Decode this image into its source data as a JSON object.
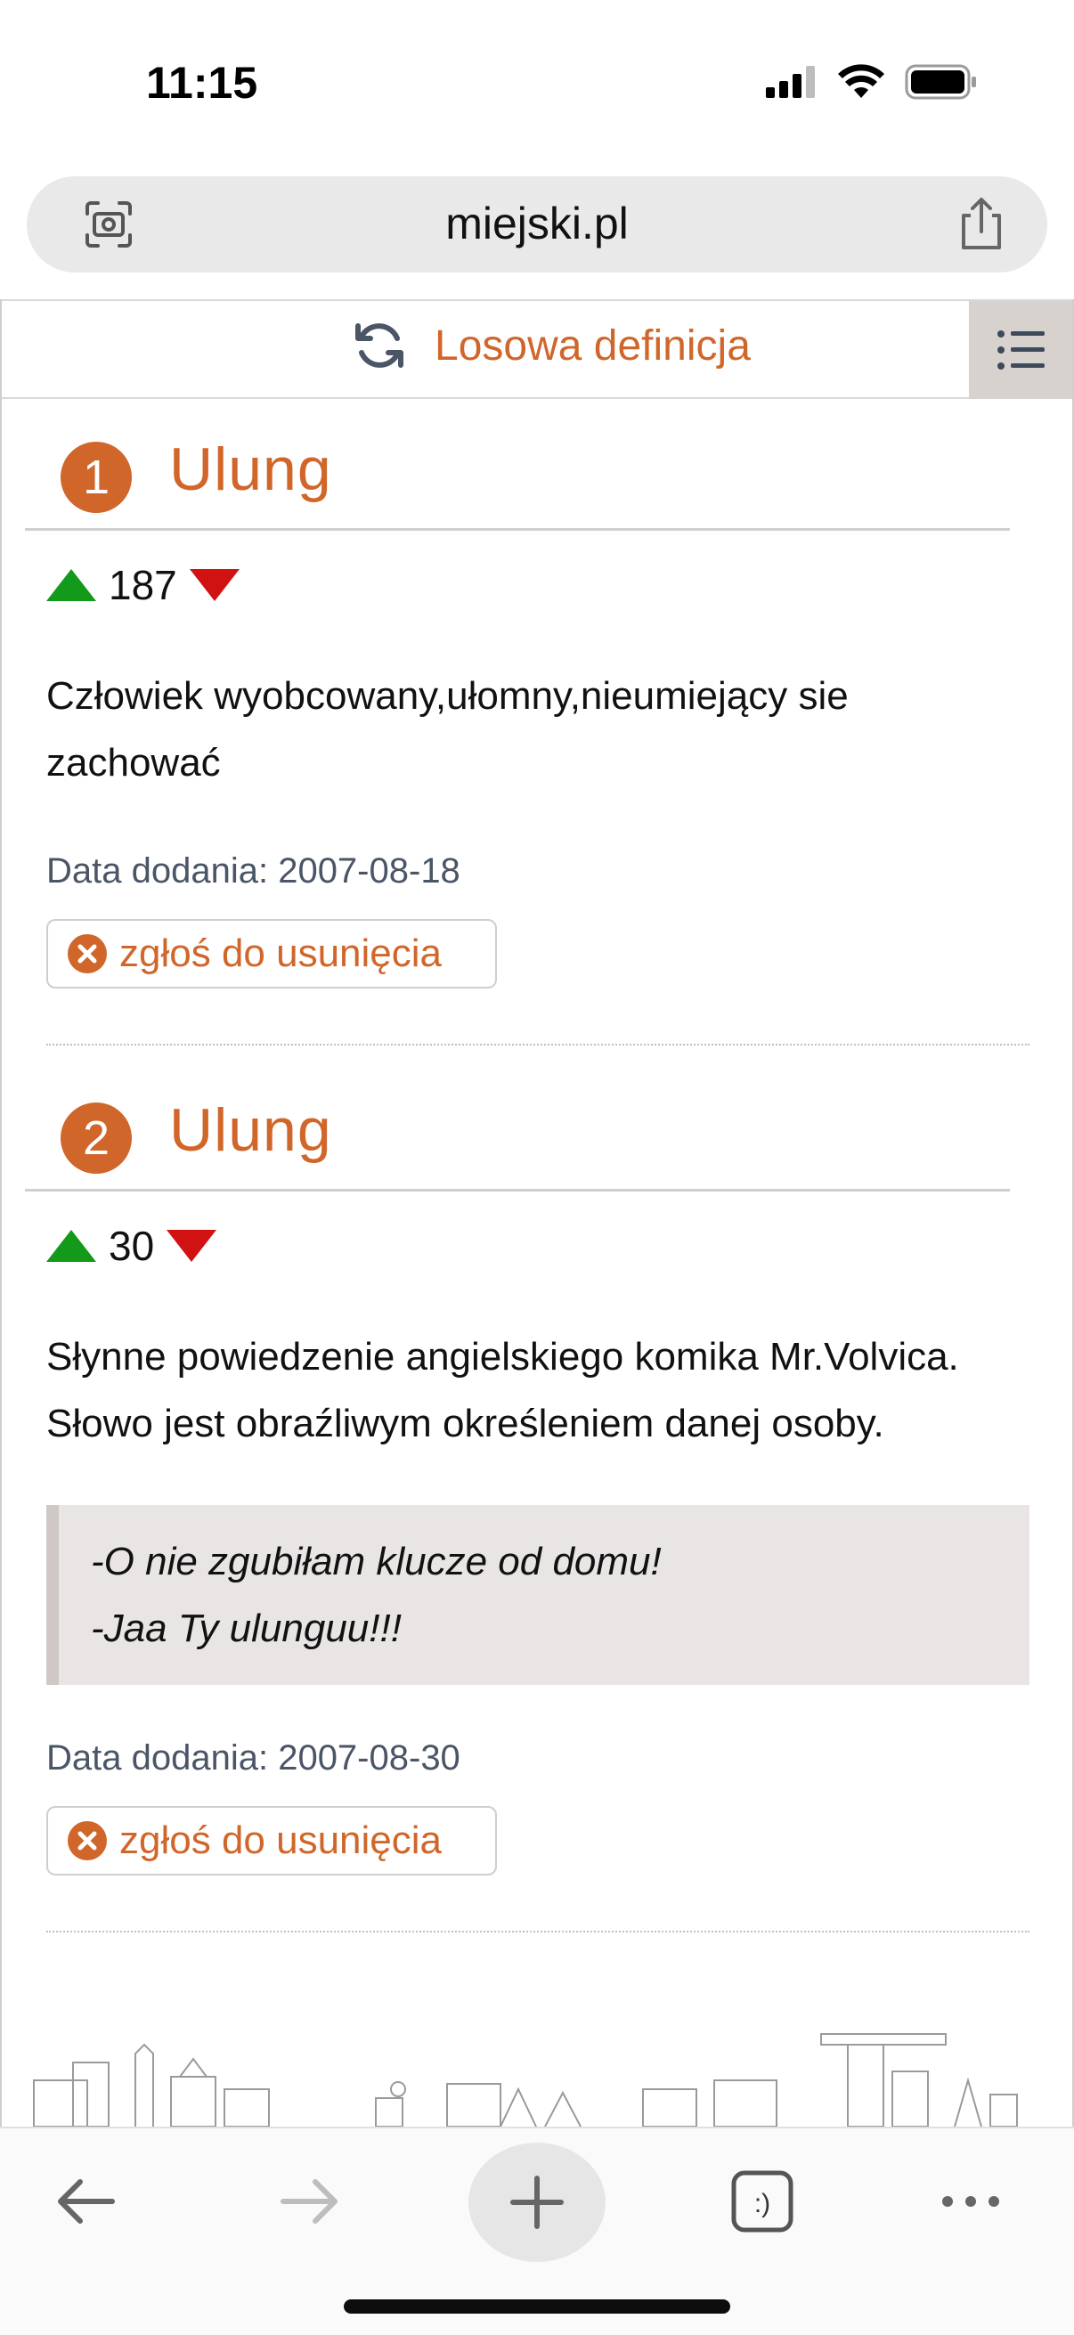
{
  "status_bar": {
    "time": "11:15"
  },
  "browser": {
    "url": "miejski.pl"
  },
  "nav": {
    "random_label": "Losowa definicja"
  },
  "entries": [
    {
      "number": "1",
      "title": "Ulung",
      "votes": "187",
      "definition": "Człowiek wyobcowany,ułomny,nieumiejący sie zachować",
      "example_lines": [],
      "date": "Data dodania: 2007-08-18",
      "report_label": "zgłoś do usunięcia"
    },
    {
      "number": "2",
      "title": "Ulung",
      "votes": "30",
      "definition": "Słynne powiedzenie angielskiego komika Mr.Volvica. Słowo jest obraźliwym określeniem danej osoby.",
      "example_lines": [
        "-O nie zgubiłam klucze od domu!",
        "-Jaa Ty ulunguu!!!"
      ],
      "date": "Data dodania: 2007-08-30",
      "report_label": "zgłoś do usunięcia"
    }
  ],
  "colors": {
    "accent": "#d0662a",
    "upvote": "#139a1a",
    "downvote": "#d11212",
    "menu_bg": "#d8d2cf"
  },
  "icons": [
    "signal-icon",
    "wifi-icon",
    "battery-icon",
    "camera-search-icon",
    "share-icon",
    "refresh-icon",
    "menu-icon",
    "back-icon",
    "forward-icon",
    "plus-icon",
    "tabs-icon",
    "more-icon"
  ]
}
